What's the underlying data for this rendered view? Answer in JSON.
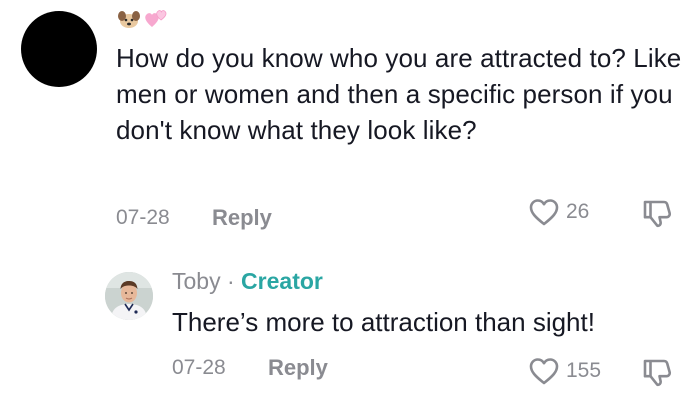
{
  "comment": {
    "text": "How do you know who you are attracted to? Like men or women and then a specific person if you don't know what they look like?",
    "date": "07-28",
    "reply_label": "Reply",
    "likes": "26"
  },
  "reply": {
    "author": "Toby",
    "separator": "·",
    "badge": "Creator",
    "text": "There’s more to attraction than sight!",
    "date": "07-28",
    "reply_label": "Reply",
    "likes": "155"
  },
  "icons": {
    "username": [
      "dog-emoji",
      "pink-hearts-emoji"
    ],
    "like": "heart-outline-icon",
    "dislike": "thumbs-down-icon"
  },
  "colors": {
    "text": "#161823",
    "muted": "#8a8b91",
    "creator_badge": "#2aa6a3"
  }
}
